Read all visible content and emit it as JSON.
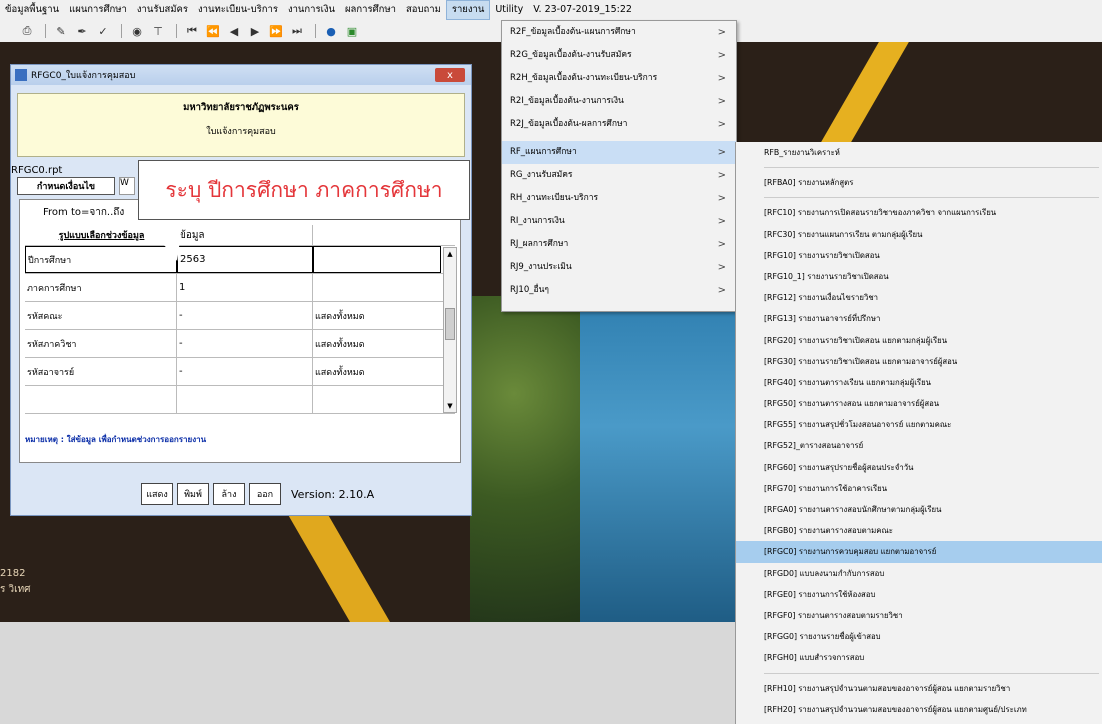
{
  "menubar": {
    "items": [
      "ข้อมูลพื้นฐาน",
      "แผนการศึกษา",
      "งานรับสมัคร",
      "งานทะเบียน-บริการ",
      "งานการเงิน",
      "ผลการศึกษา",
      "สอบถาม",
      "รายงาน",
      "Utility",
      "V. 23-07-2019_15:22"
    ]
  },
  "toolbar": {
    "icons": [
      "print-icon",
      "pen-icon",
      "edit-icon",
      "edit2-icon",
      "binoculars-icon",
      "filter-icon",
      "first-icon",
      "prev-page-icon",
      "prev-icon",
      "next-icon",
      "next-page-icon",
      "last-icon",
      "globe-icon",
      "exit-icon"
    ]
  },
  "dialog": {
    "title": "RFGC0_ใบแจ้งการคุมสอบ",
    "close": "x",
    "header_title": "มหาวิทยาลัยราชภัฏพระนคร",
    "header_sub": "ใบแจ้งการคุมสอบ",
    "file": "RFGC0.rpt",
    "tab": "กำหนดเงื่อนไข",
    "tab_extra": "W",
    "range_text": "From to=จาก..ถึง",
    "grid_headers": [
      "รูปแบบเลือกช่วงข้อมูล",
      "ข้อมูล",
      ""
    ],
    "rows": [
      {
        "label": "ปีการศึกษา",
        "value": "2563",
        "note": ""
      },
      {
        "label": "ภาคการศึกษา",
        "value": "1",
        "note": ""
      },
      {
        "label": "รหัสคณะ",
        "value": "-",
        "note": "แสดงทั้งหมด"
      },
      {
        "label": "รหัสภาควิชา",
        "value": "-",
        "note": "แสดงทั้งหมด"
      },
      {
        "label": "รหัสอาจารย์",
        "value": "-",
        "note": "แสดงทั้งหมด"
      }
    ],
    "note": "หมายเหตุ : ใส่ข้อมูล เพื่อกำหนดช่วงการออกรายงาน",
    "buttons": [
      "แสดง",
      "พิมพ์",
      "ล้าง",
      "ออก"
    ],
    "version": "Version: 2.10.A"
  },
  "callout": {
    "text": "ระบุ ปีการศึกษา ภาคการศึกษา"
  },
  "background": {
    "text1": "2182",
    "text2": "ร วิเทศ"
  },
  "menu1": {
    "items": [
      {
        "label": "R2F_ข้อมูลเบื้องต้น-แผนการศึกษา",
        "arrow": ">"
      },
      {
        "label": "R2G_ข้อมูลเบื้องต้น-งานรับสมัคร",
        "arrow": ">"
      },
      {
        "label": "R2H_ข้อมูลเบื้องต้น-งานทะเบียน-บริการ",
        "arrow": ">"
      },
      {
        "label": "R2I_ข้อมูลเบื้องต้น-งานการเงิน",
        "arrow": ">"
      },
      {
        "label": "R2J_ข้อมูลเบื้องต้น-ผลการศึกษา",
        "arrow": ">"
      },
      {
        "label": "RF_แผนการศึกษา",
        "arrow": ">"
      },
      {
        "label": "RG_งานรับสมัคร",
        "arrow": ">"
      },
      {
        "label": "RH_งานทะเบียน-บริการ",
        "arrow": ">"
      },
      {
        "label": "RI_งานการเงิน",
        "arrow": ">"
      },
      {
        "label": "RJ_ผลการศึกษา",
        "arrow": ">"
      },
      {
        "label": "RJ9_งานประเมิน",
        "arrow": ">"
      },
      {
        "label": "RJ10_อื่นๆ",
        "arrow": ">"
      }
    ]
  },
  "menu2": {
    "items": [
      "RFB_รายงานวิเคราะห์",
      "[RFBA0] รายงานหลักสูตร",
      "[RFC10] รายงานการเปิดสอนรายวิชาของภาควิชา จากแผนการเรียน",
      "[RFC30] รายงานแผนการเรียน ตามกลุ่มผู้เรียน",
      "[RFG10] รายงานรายวิชาเปิดสอน",
      "[RFG10_1] รายงานรายวิชาเปิดสอน",
      "[RFG12] รายงานเงื่อนไขรายวิชา",
      "[RFG13] รายงานอาจารย์ที่ปรึกษา",
      "[RFG20] รายงานรายวิชาเปิดสอน แยกตามกลุ่มผู้เรียน",
      "[RFG30] รายงานรายวิชาเปิดสอน แยกตามอาจารย์ผู้สอน",
      "[RFG40] รายงานตารางเรียน แยกตามกลุ่มผู้เรียน",
      "[RFG50] รายงานตารางสอน แยกตามอาจารย์ผู้สอน",
      "[RFG55] รายงานสรุปชั่วโมงสอนอาจารย์ แยกตามคณะ",
      "[RFG52]_ตารางสอนอาจารย์",
      "[RFG60] รายงานสรุปรายชื่อผู้สอนประจำวัน",
      "[RFG70] รายงานการใช้อาคารเรียน",
      "[RFGA0] รายงานตารางสอบนักศึกษาตามกลุ่มผู้เรียน",
      "[RFGB0] รายงานตารางสอบตามคณะ",
      "[RFGC0] รายงานการควบคุมสอบ แยกตามอาจารย์",
      "[RFGD0] แบบลงนามกำกับการสอบ",
      "[RFGE0] รายงานการใช้ห้องสอบ",
      "[RFGF0] รายงานตารางสอบตามรายวิชา",
      "[RFGG0] รายงานรายชื่อผู้เข้าสอบ",
      "[RFGH0] แบบสำรวจการสอบ",
      "[RFH10] รายงานสรุปจำนวนตามสอบของอาจารย์ผู้สอน แยกตามรายวิชา",
      "[RFH20] รายงานสรุปจำนวนตามสอบของอาจารย์ผู้สอน แยกตามศูนย์/ประเภท"
    ]
  }
}
